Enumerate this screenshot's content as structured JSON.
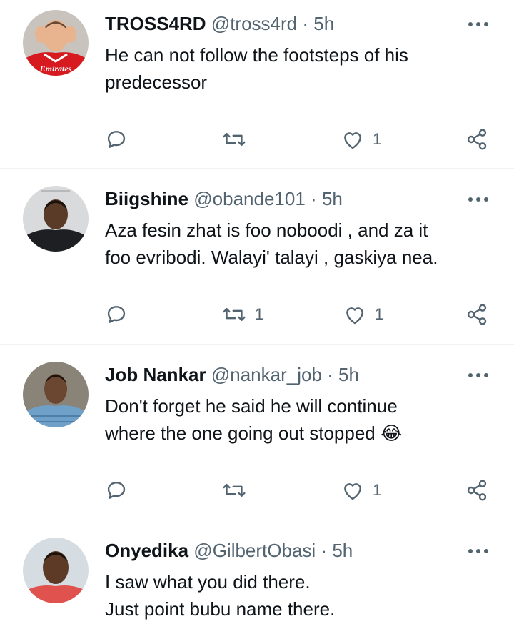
{
  "tweets": [
    {
      "name": "TROSS4RD",
      "handle": "@tross4rd",
      "sep": "·",
      "time": "5h",
      "text": "He can not follow the footsteps of his\npredecessor",
      "emoji": "",
      "retweets": "",
      "likes": "1",
      "avatar_jersey_text": "Emirates",
      "colors": {
        "avatar_bg": "#c8c4bd",
        "jersey": "#d71920",
        "skin": "#e8b48f"
      }
    },
    {
      "name": "Biigshine",
      "handle": "@obande101",
      "sep": "·",
      "time": "5h",
      "text": "Aza fesin zhat is foo noboodi , and za it\nfoo evribodi. Walayi' talayi , gaskiya nea.",
      "emoji": "",
      "retweets": "1",
      "likes": "1",
      "colors": {
        "avatar_bg": "#d9dadc",
        "shirt": "#1d1f22",
        "skin": "#5a3b28"
      }
    },
    {
      "name": "Job Nankar",
      "handle": "@nankar_job",
      "sep": "·",
      "time": "5h",
      "text": "Don't forget he said he will continue\nwhere the one going out stopped ",
      "emoji": "😂",
      "retweets": "",
      "likes": "1",
      "colors": {
        "avatar_bg": "#8a8478",
        "shirt": "#6fa0c8",
        "skin": "#6b4630"
      }
    },
    {
      "name": "Onyedika",
      "handle": "@GilbertObasi",
      "sep": "·",
      "time": "5h",
      "text": "I saw what you did there.\nJust point bubu name there.",
      "emoji": "",
      "retweets": "",
      "likes": "",
      "colors": {
        "avatar_bg": "#d6dde2",
        "shirt": "#e0524e",
        "skin": "#5c3a26"
      }
    }
  ],
  "icons": {
    "more": "more-icon",
    "reply": "reply-icon",
    "retweet": "retweet-icon",
    "like": "like-icon",
    "share": "share-icon"
  },
  "colors": {
    "text": "#0f1419",
    "secondary": "#536471",
    "divider": "#eff3f4"
  }
}
